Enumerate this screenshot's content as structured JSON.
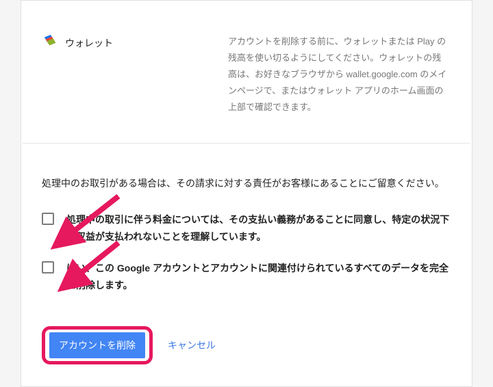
{
  "wallet": {
    "title": "ウォレット",
    "text": "アカウントを削除する前に、ウォレットまたは Play の残高を使い切るようにしてください。ウォレットの残高は、お好きなブラウザから wallet.google.com のメインページで、またはウォレット アプリのホーム画面の上部で確認できます。"
  },
  "confirm": {
    "note": "処理中のお取引がある場合は、その請求に対する責任がお客様にあることにご留意ください。",
    "check1": "処理中の取引に伴う料金については、その支払い義務があることに同意し、特定の状況下で収益が支払われないことを理解しています。",
    "check2": "はい、この Google アカウントとアカウントに関連付けられているすべてのデータを完全に削除します。"
  },
  "actions": {
    "delete": "アカウントを削除",
    "cancel": "キャンセル"
  },
  "colors": {
    "accent": "#e6185e",
    "primary": "#4285f4"
  }
}
